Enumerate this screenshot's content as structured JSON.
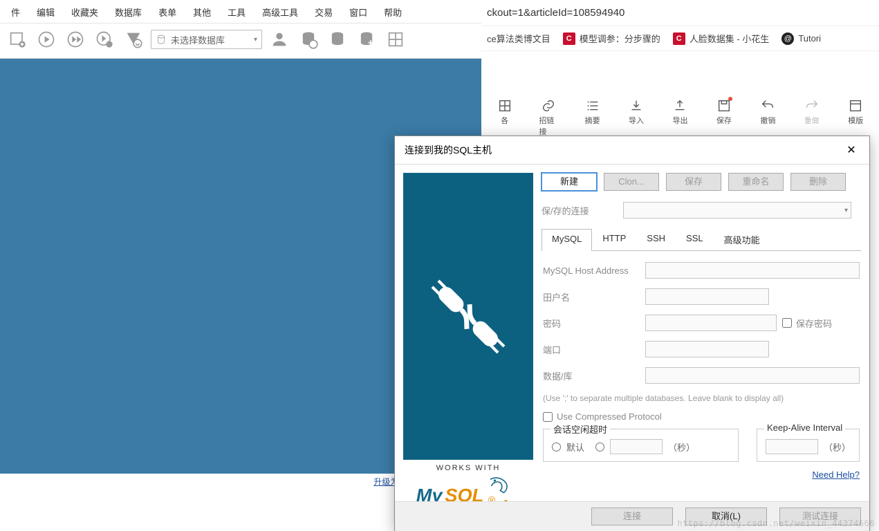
{
  "menu": {
    "items": [
      "件",
      "编辑",
      "收藏夹",
      "数据库",
      "表单",
      "其他",
      "工具",
      "高级工具",
      "交易",
      "窗口",
      "帮助"
    ]
  },
  "toolbar": {
    "db_placeholder": "未选择数据库"
  },
  "upgrade_link": "升级为 SQLyog 专业版／企",
  "browser": {
    "url": "ckout=1&articleId=108594940",
    "bookmarks": [
      {
        "icon": "",
        "label": "ce算法类博文目"
      },
      {
        "icon": "C",
        "label": "模型调参：分步骤的"
      },
      {
        "icon": "C",
        "label": "人脸数据集 - 小花生"
      },
      {
        "icon": "@",
        "label": "Tutori"
      }
    ],
    "editor": [
      {
        "icon": "grid",
        "label": "各"
      },
      {
        "icon": "link",
        "label": "招链接"
      },
      {
        "icon": "list",
        "label": "摘要"
      },
      {
        "icon": "download",
        "label": "导入"
      },
      {
        "icon": "upload",
        "label": "导出"
      },
      {
        "icon": "save",
        "label": "保存",
        "dot": true
      },
      {
        "icon": "undo",
        "label": "撤销"
      },
      {
        "icon": "redo",
        "label": "重做",
        "muted": true
      },
      {
        "icon": "template",
        "label": "模版"
      }
    ]
  },
  "dialog": {
    "title": "连接到我的SQL主机",
    "buttons": {
      "new": "新建",
      "clone": "Clon...",
      "save": "保存",
      "rename": "重命名",
      "delete": "删除"
    },
    "saved_label": "保/存的连接",
    "tabs": [
      "MySQL",
      "HTTP",
      "SSH",
      "SSL",
      "高级功能"
    ],
    "active_tab": 0,
    "fields": {
      "host": {
        "label": "MySQL Host Address",
        "value": ""
      },
      "user": {
        "label": "田户名",
        "value": ""
      },
      "password": {
        "label": "密码",
        "value": "",
        "save_label": "保存密码"
      },
      "port": {
        "label": "端口",
        "value": ""
      },
      "database": {
        "label": "数据/库",
        "value": ""
      }
    },
    "db_hint": "(Use ';' to separate multiple databases. Leave blank to display all)",
    "compress_label": "Use Compressed Protocol",
    "idle_group": {
      "title": "会话空闲超时",
      "default_label": "默认",
      "unit": "（秒）"
    },
    "keepalive_group": {
      "title": "Keep-Alive Interval",
      "unit": "（秒）"
    },
    "help_link": "Need Help?",
    "footer": {
      "connect": "连接",
      "cancel": "取消(L)",
      "test": "测试连接"
    },
    "brand": {
      "works_with": "WORKS WITH",
      "logo_text": "MySQL"
    }
  },
  "watermark": "https://blog.csdn.net/weixin_44374666"
}
